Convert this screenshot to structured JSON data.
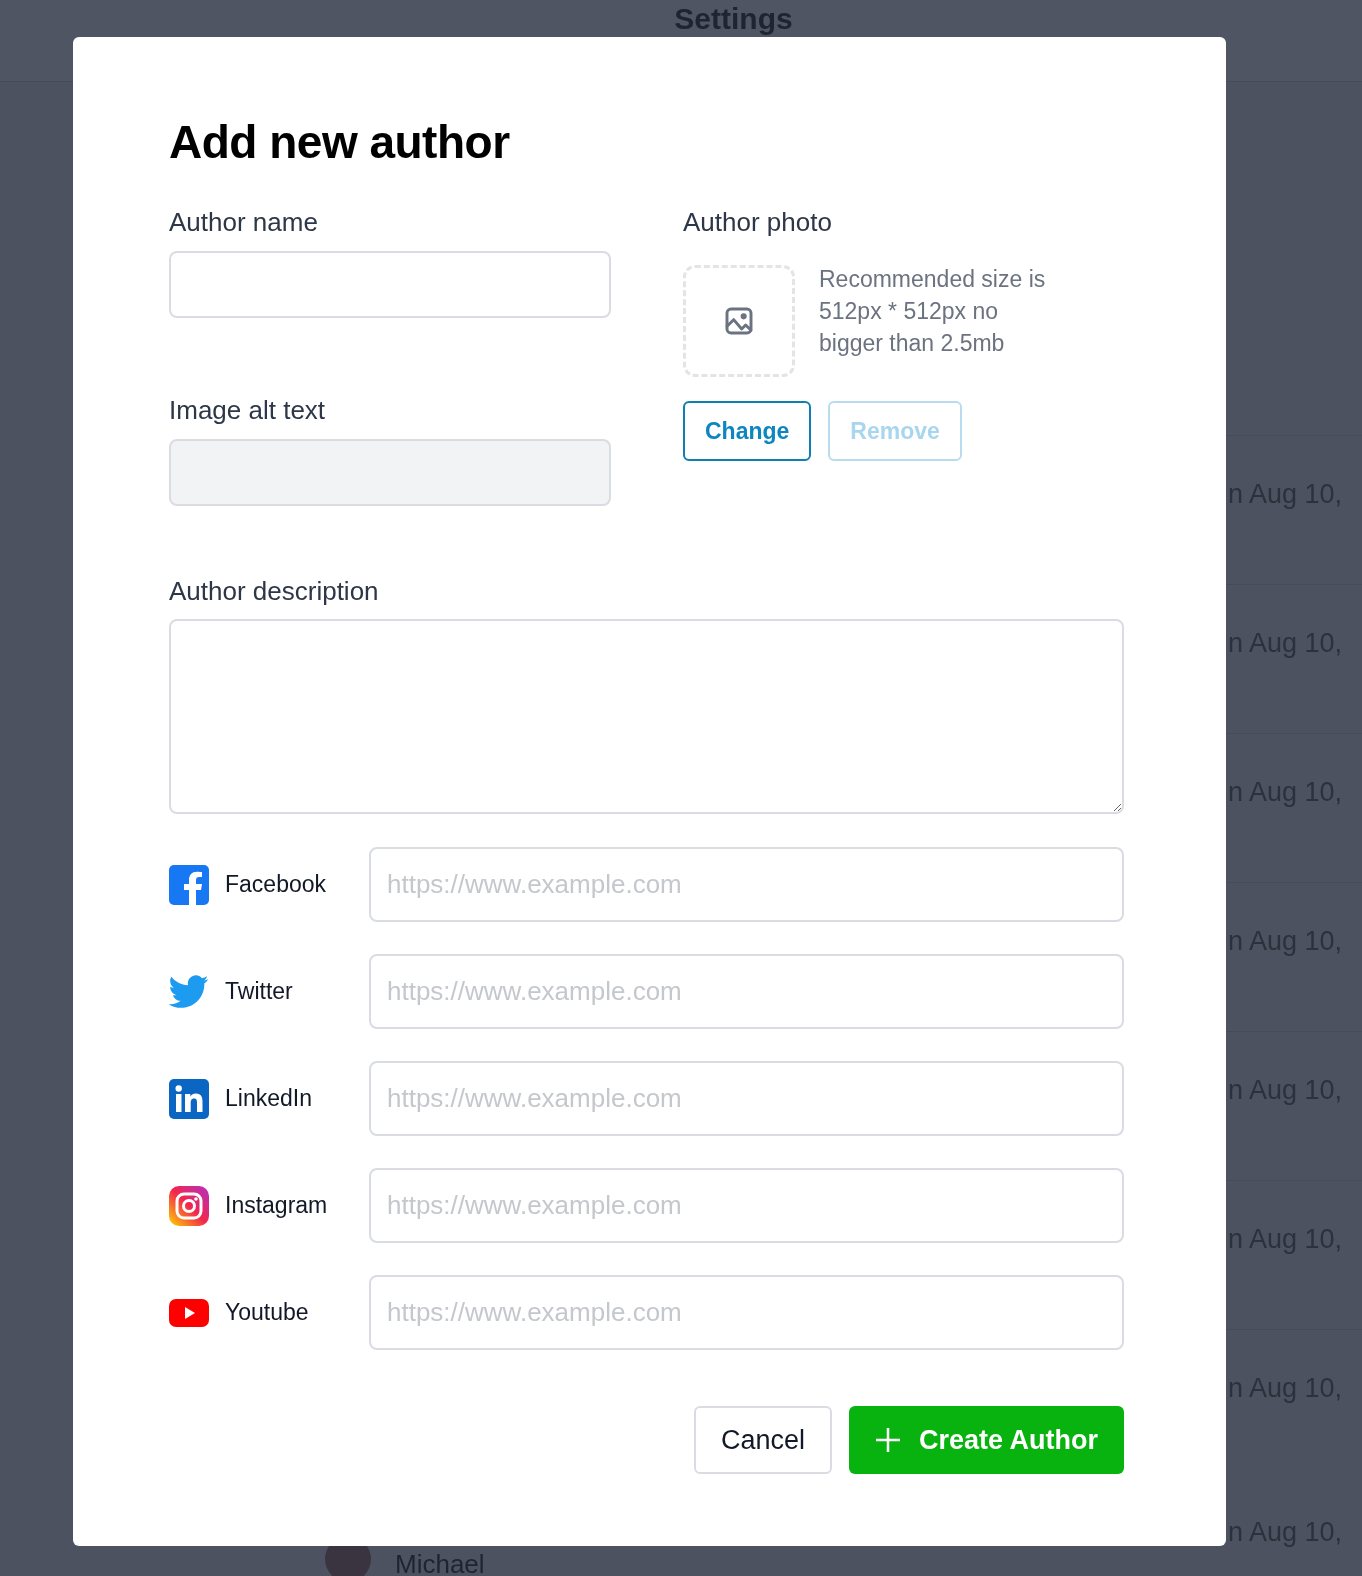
{
  "background": {
    "title": "Settings",
    "rows": [
      "n Aug 10,",
      "n Aug 10,",
      "n Aug 10,",
      "n Aug 10,",
      "n Aug 10,",
      "n Aug 10,",
      "n Aug 10,"
    ],
    "last_row": {
      "name": "Michael",
      "updated": "n Aug 10,"
    }
  },
  "dialog": {
    "title": "Add new author",
    "name_field": {
      "label": "Author name"
    },
    "alt_field": {
      "label": "Image alt text",
      "disabled": true
    },
    "photo": {
      "label": "Author photo",
      "hint": "Recommended size is 512px * 512px no bigger than 2.5mb",
      "buttons": [
        {
          "label": "Change",
          "disabled": false
        },
        {
          "label": "Remove",
          "disabled": true
        }
      ]
    },
    "description": {
      "label": "Author description"
    },
    "socials": [
      {
        "kind": "facebook",
        "label": "Facebook",
        "placeholder": "https://www.example.com"
      },
      {
        "kind": "twitter",
        "label": "Twitter",
        "placeholder": "https://www.example.com"
      },
      {
        "kind": "linkedin",
        "label": "LinkedIn",
        "placeholder": "https://www.example.com"
      },
      {
        "kind": "instagram",
        "label": "Instagram",
        "placeholder": "https://www.example.com"
      },
      {
        "kind": "youtube",
        "label": "Youtube",
        "placeholder": "https://www.example.com"
      }
    ],
    "actions": [
      {
        "kind": "secondary",
        "label": "Cancel"
      },
      {
        "kind": "primary",
        "label": "Create Author"
      }
    ]
  }
}
